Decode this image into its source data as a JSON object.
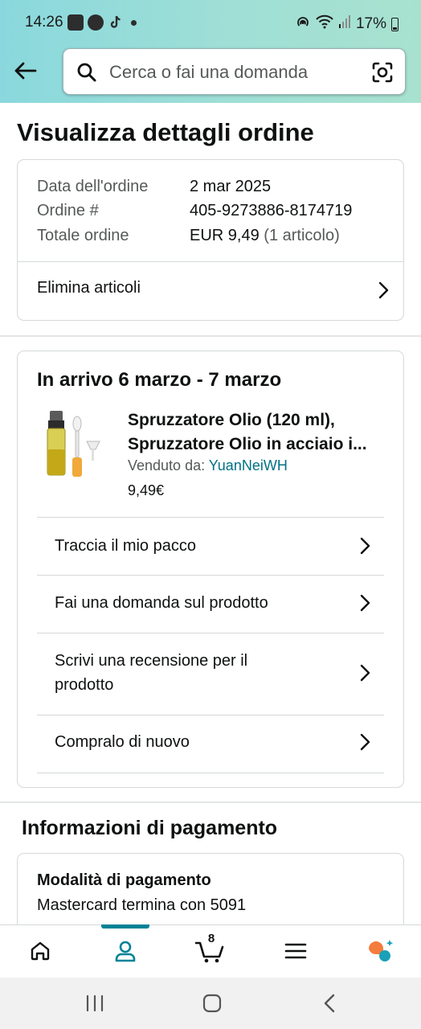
{
  "status_bar": {
    "time": "14:26",
    "battery": "17%"
  },
  "search": {
    "placeholder": "Cerca o fai una domanda"
  },
  "page": {
    "title": "Visualizza dettagli ordine"
  },
  "order_summary": {
    "date_label": "Data dell'ordine",
    "date_value": "2 mar 2025",
    "number_label": "Ordine #",
    "number_value": "405-9273886-8174719",
    "total_label": "Totale ordine",
    "total_value": "EUR 9,49",
    "total_items": "(1 articolo)",
    "delete_items": "Elimina articoli"
  },
  "shipment": {
    "arrival": "In arrivo 6 marzo - 7 marzo",
    "product_title_line1": "Spruzzatore Olio (120 ml),",
    "product_title_line2": "Spruzzatore Olio in acciaio i...",
    "sold_by_label": "Venduto da:",
    "seller": "YuanNeiWH",
    "price": "9,49€",
    "actions": [
      {
        "label": "Traccia il mio pacco"
      },
      {
        "label": "Fai una domanda sul prodotto"
      },
      {
        "label": "Scrivi una recensione per il prodotto"
      },
      {
        "label": "Compralo di nuovo"
      }
    ]
  },
  "payment": {
    "section_title": "Informazioni di pagamento",
    "method_label": "Modalità di pagamento",
    "method_value": "Mastercard termina con 5091"
  },
  "bottom_nav": {
    "cart_count": "8",
    "active": "account",
    "accent_color": "#008296"
  },
  "colors": {
    "header_gradient_start": "#8ad8dd",
    "header_gradient_end": "#a8e2cf",
    "link": "#007185",
    "text": "#0F1111",
    "muted": "#565959"
  }
}
